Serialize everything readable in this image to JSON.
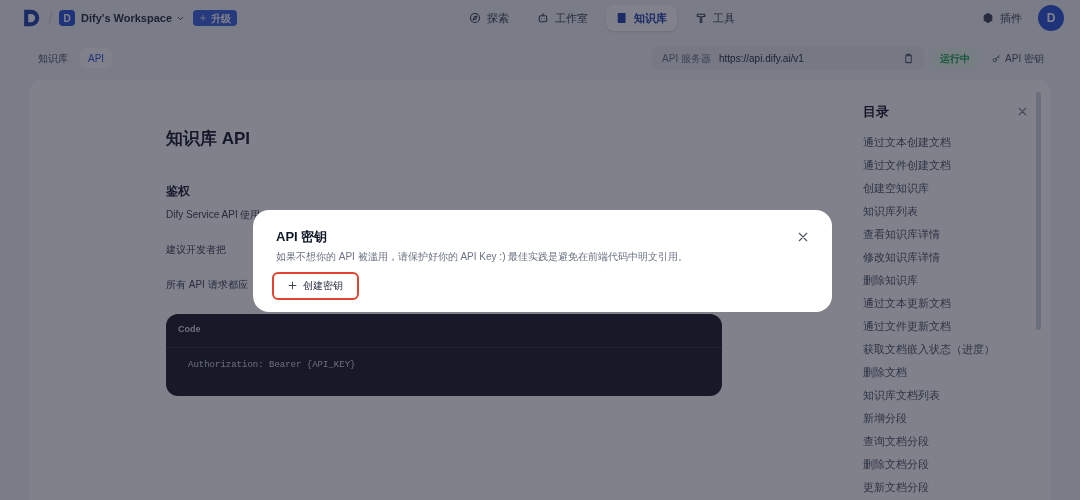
{
  "top_bar": {
    "workspace": {
      "avatar": "D",
      "name": "Dify's Workspace"
    },
    "upgrade_button": "升级",
    "nav": [
      {
        "label": "探索",
        "selected": false
      },
      {
        "label": "工作室",
        "selected": false
      },
      {
        "label": "知识库",
        "selected": true
      },
      {
        "label": "工具",
        "selected": false
      }
    ],
    "plugins": "插件",
    "user_avatar": "D"
  },
  "breadcrumb": [
    {
      "label": "知识库",
      "selected": false
    },
    {
      "label": "API",
      "selected": true
    }
  ],
  "api_server": {
    "label": "API 服务器",
    "url": "https://api.dify.ai/v1"
  },
  "status": "运行中",
  "api_key_button": "API 密钥",
  "doc": {
    "title": "知识库 API",
    "section": "鉴权",
    "lines": [
      "Dify Service API 使用",
      "建议开发者把",
      "所有 API 请求都应"
    ],
    "code": {
      "header": "Code",
      "body": "Authorization: Bearer {API_KEY}"
    }
  },
  "toc": {
    "title": "目录",
    "items": [
      "通过文本创建文档",
      "通过文件创建文档",
      "创建空知识库",
      "知识库列表",
      "查看知识库详情",
      "修改知识库详情",
      "删除知识库",
      "通过文本更新文档",
      "通过文件更新文档",
      "获取文档嵌入状态（进度）",
      "删除文档",
      "知识库文档列表",
      "新增分段",
      "查询文档分段",
      "删除文档分段",
      "更新文档分段"
    ]
  },
  "modal": {
    "title": "API 密钥",
    "description": "如果不想你的 API 被滥用，请保护好你的 API Key :) 最佳实践是避免在前端代码中明文引用。",
    "create_button": "创建密钥",
    "highlighted": true
  }
}
